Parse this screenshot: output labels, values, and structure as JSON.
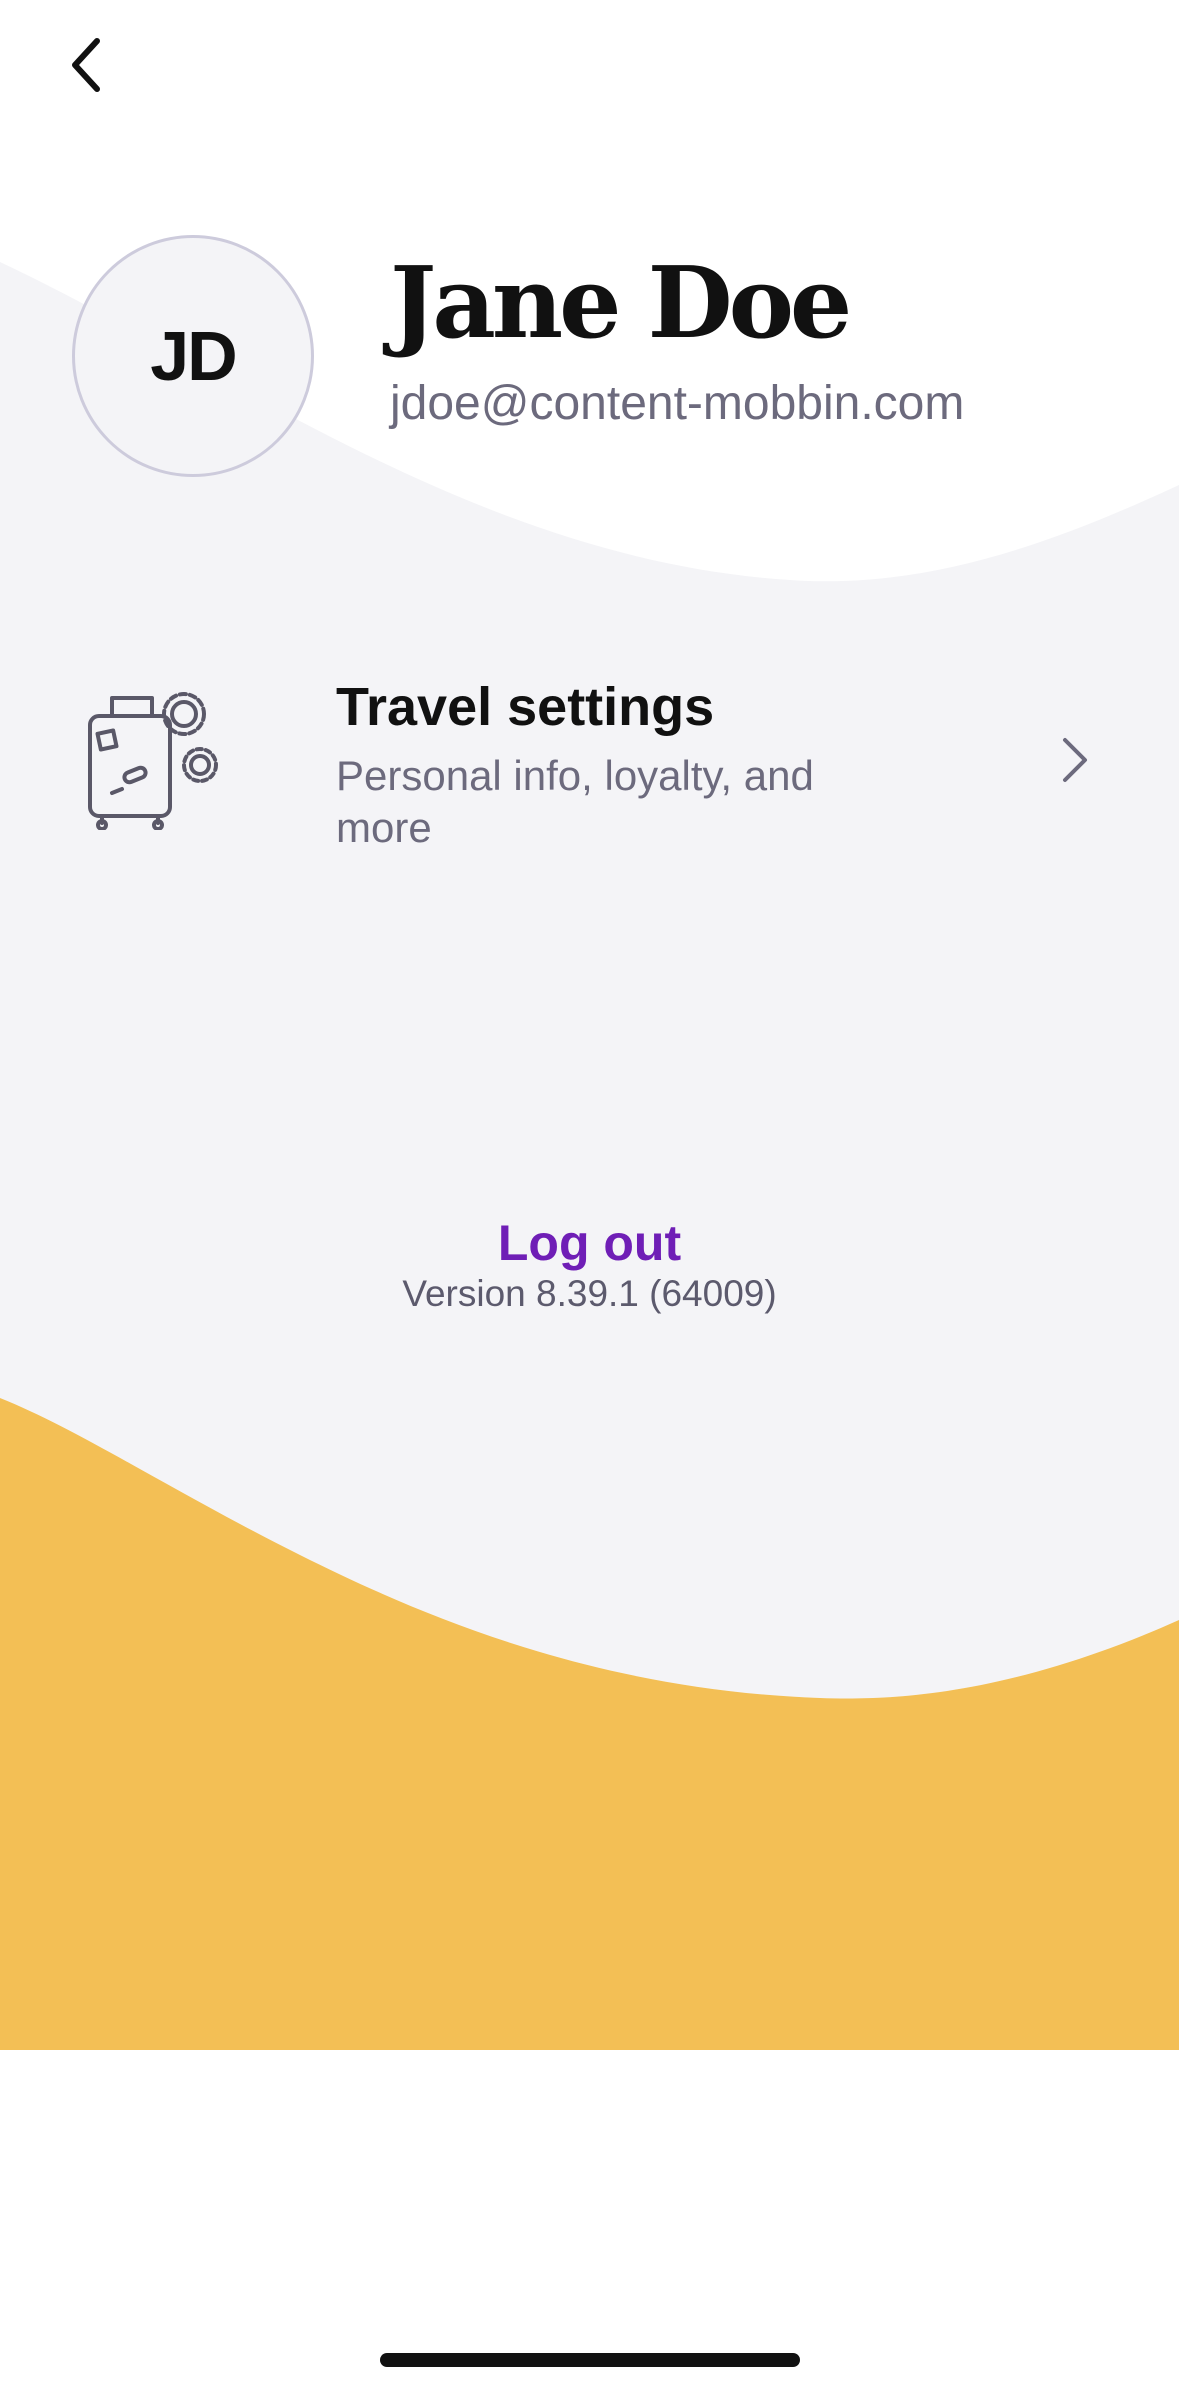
{
  "header": {
    "back_icon": "chevron-left-icon"
  },
  "profile": {
    "initials": "JD",
    "name": "Jane Doe",
    "email": "jdoe@content-mobbin.com"
  },
  "travel_settings": {
    "icon": "luggage-gear-icon",
    "title": "Travel settings",
    "subtitle": "Personal info, loyalty, and more",
    "chevron_icon": "chevron-right-icon"
  },
  "footer": {
    "logout_label": "Log out",
    "version": "Version 8.39.1 (64009)"
  },
  "colors": {
    "background": "#ffffff",
    "wave_gray": "#f4f4f7",
    "wave_yellow": "#f3bf55",
    "accent_purple": "#6f1eb6",
    "text_primary": "#111111",
    "text_secondary": "#6c6a7d"
  }
}
